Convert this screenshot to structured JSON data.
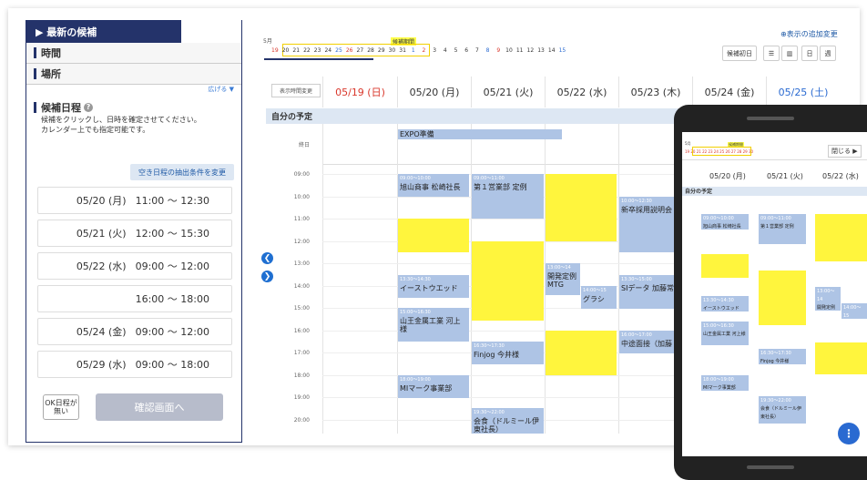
{
  "left": {
    "title": "▶ 最新の候補",
    "sec_time": "時間",
    "sec_place": "場所",
    "expand": "広げる ▼",
    "kouho_title": "候補日程",
    "help": "?",
    "desc1": "候補をクリックし、日時を確定させてください。",
    "desc2": "カレンダー上でも指定可能です。",
    "cond_button": "空き日程の抽出条件を変更",
    "slots": [
      {
        "date": "05/20 (月)",
        "time": "11:00 ～ 12:30"
      },
      {
        "date": "05/21 (火)",
        "time": "12:00 ～ 15:30"
      },
      {
        "date": "05/22 (水)",
        "time": "09:00 ～ 12:00"
      },
      {
        "date": "",
        "time": "16:00 ～ 18:00"
      },
      {
        "date": "05/24 (金)",
        "time": "09:00 ～ 12:00"
      },
      {
        "date": "05/29 (水)",
        "time": "09:00 ～ 18:00"
      }
    ],
    "ok_button": "OK日程が無い",
    "confirm_button": "確認画面へ"
  },
  "strip": {
    "month": "5月",
    "kouho_label": "候補期間",
    "days": [
      "19",
      "20",
      "21",
      "22",
      "23",
      "24",
      "25",
      "26",
      "27",
      "28",
      "29",
      "30",
      "31",
      "1",
      "2",
      "3",
      "4",
      "5",
      "6",
      "7",
      "8",
      "9",
      "10",
      "11",
      "12",
      "13",
      "14",
      "15"
    ],
    "add_view": "表示の追加変更",
    "first_day_button": "候補初日",
    "day_button": "日",
    "week_button": "週"
  },
  "calendar": {
    "display_time_button": "表示時間変更",
    "headers": [
      "05/19 (日)",
      "05/20 (月)",
      "05/21 (火)",
      "05/22 (水)",
      "05/23 (木)",
      "05/24 (金)",
      "05/25 (土)"
    ],
    "my_schedule": "自分の予定",
    "allday": "終日",
    "allday_event": "EXPO準備",
    "times": [
      "09:00",
      "10:00",
      "11:00",
      "12:00",
      "13:00",
      "14:00",
      "15:00",
      "16:00",
      "17:00",
      "18:00",
      "19:00",
      "20:00"
    ],
    "events": {
      "e1_time": "09:00～10:00",
      "e1": "旭山商事 松崎社長",
      "e2_time": "09:00～11:00",
      "e2": "第１営業部 定例",
      "e3_time": "13:30～14:30",
      "e3": "イーストウエッド",
      "e4_time": "15:00～16:30",
      "e4": "山王金属工業 河上様",
      "e5_time": "18:00～19:00",
      "e5": "MIマーク事業部",
      "e6_time": "16:30～17:30",
      "e6": "Finjog 今井様",
      "e7_time": "19:30～22:00",
      "e7": "会食（ドルミール伊東社長）",
      "e8_time": "13:00～14",
      "e8": "開発定例MTG",
      "e9_time": "14:00～15",
      "e9": "グラシ",
      "e10_time": "10:00～12:30",
      "e10": "新卒採用説明会",
      "e11_time": "13:30～15:00",
      "e11": "SIデータ 加藤常",
      "e12_time": "16:00～17:00",
      "e12": "中途面接（加藤"
    }
  },
  "phone": {
    "month": "5月",
    "kouho_label": "候補期間",
    "close": "閉じる ▶",
    "headers": [
      "05/20 (月)",
      "05/21 (火)",
      "05/22 (水)"
    ],
    "my_schedule": "自分の予定",
    "fab": "⋮"
  },
  "nav": {
    "prev": "❮",
    "next": "❯"
  }
}
